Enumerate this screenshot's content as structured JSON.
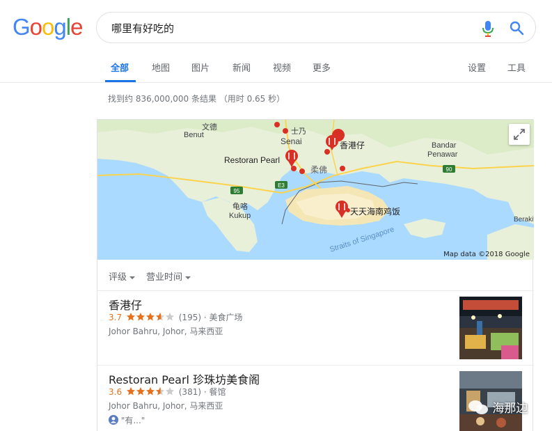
{
  "logo": "Google",
  "search": {
    "query": "哪里有好吃的"
  },
  "tabs": [
    {
      "label": "全部",
      "active": true
    },
    {
      "label": "地图"
    },
    {
      "label": "图片"
    },
    {
      "label": "新闻"
    },
    {
      "label": "视频"
    },
    {
      "label": "更多"
    },
    {
      "label": "设置"
    },
    {
      "label": "工具"
    }
  ],
  "stats": "找到约 836,000,000 条结果 （用时 0.65 秒）",
  "map": {
    "labels": {
      "wende": "文德",
      "benut": "Benut",
      "shinai": "士乃",
      "senai": "Senai",
      "hongkong_boy": "香港仔",
      "restoran_pearl": "Restoran Pearl",
      "johor": "柔佛",
      "bandar": "Bandar",
      "penawar": "Penawar",
      "tiantian": "天天海南鸡饭",
      "kukup_cn": "龟咯",
      "kukup": "Kukup",
      "strait": "Straits of Singapore",
      "route_95": "95",
      "route_e3": "E3",
      "route_90": "90",
      "berakit": "Berakit"
    },
    "attribution": "Map data ©2018 Google"
  },
  "filters": [
    {
      "label": "评级"
    },
    {
      "label": "营业时间"
    }
  ],
  "listings": [
    {
      "name": "香港仔",
      "rating": "3.7",
      "stars": 3.7,
      "reviews": "(195)",
      "category": "· 美食广场",
      "address": "Johor Bahru, Johor, 马来西亚",
      "review_snippet": ""
    },
    {
      "name": "Restoran Pearl 珍珠坊美食阁",
      "rating": "3.6",
      "stars": 3.6,
      "reviews": "(381)",
      "category": "· 餐馆",
      "address": "Johor Bahru, Johor, 马来西亚",
      "review_snippet": "\"有...\""
    }
  ],
  "watermark": "海那边",
  "colors": {
    "accent": "#1a73e8",
    "star": "#e7711b",
    "pin": "#d93025"
  }
}
